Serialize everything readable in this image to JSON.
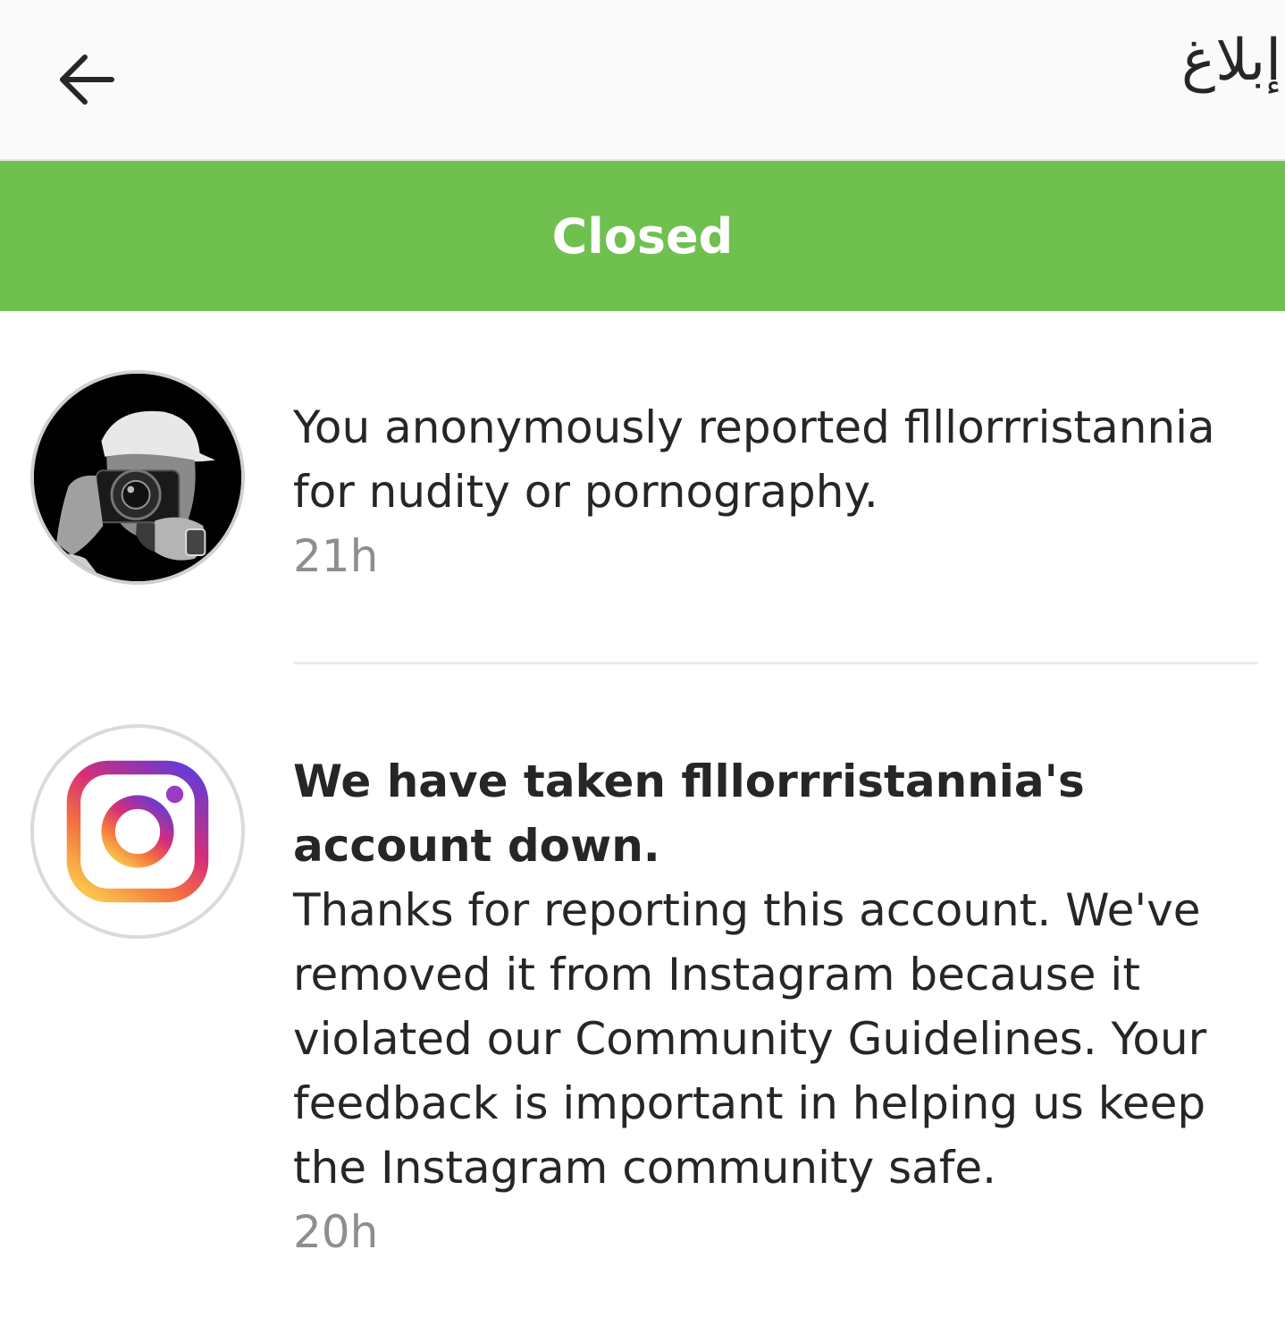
{
  "header": {
    "back_icon": "arrow-left-icon",
    "title": "إبلاغ"
  },
  "status": {
    "label": "Closed",
    "color": "#70c050"
  },
  "reports": [
    {
      "avatar": "photographer-avatar",
      "message": "You anonymously reported flllorrristannia for nudity or pornography.",
      "time": "21h"
    },
    {
      "avatar": "instagram-logo-icon",
      "headline": "We have taken flllorrristannia's account down.",
      "message": "Thanks for reporting this account. We've removed it from Instagram because it violated our Community Guidelines. Your feedback is important in helping us keep the Instagram community safe.",
      "time": "20h"
    }
  ]
}
